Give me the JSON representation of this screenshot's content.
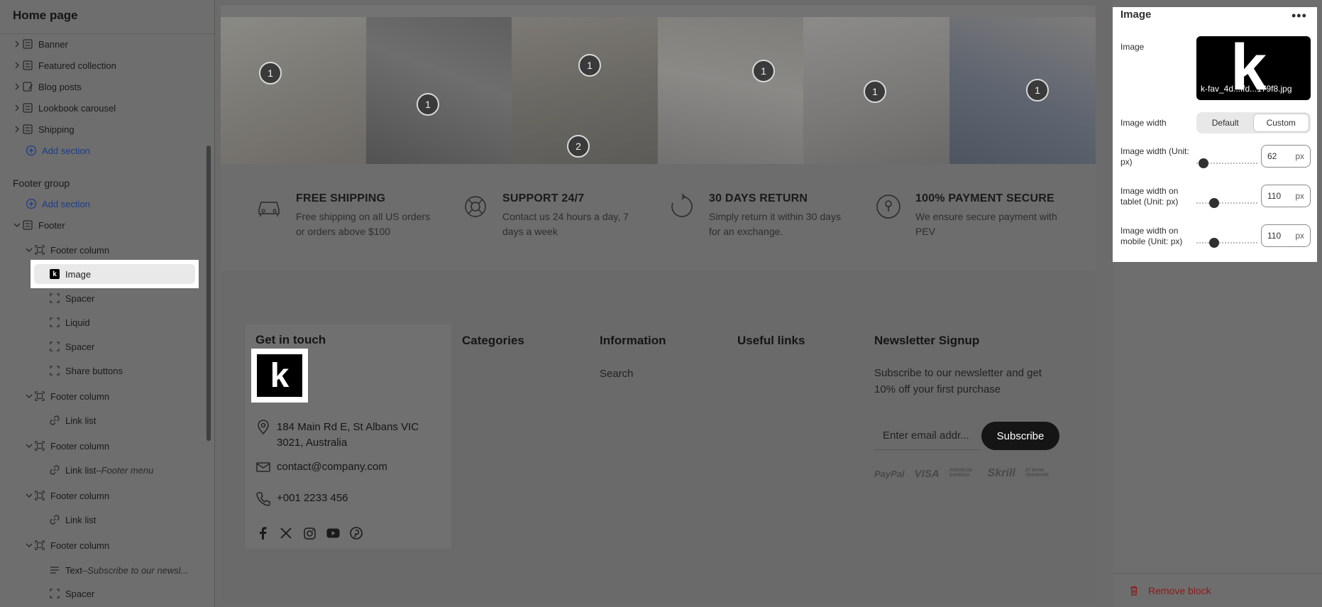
{
  "sidebar": {
    "title": "Home page",
    "sections": [
      {
        "label": "Banner",
        "icon": "section-icon"
      },
      {
        "label": "Featured collection",
        "icon": "section-icon"
      },
      {
        "label": "Blog posts",
        "icon": "blog-icon"
      },
      {
        "label": "Lookbook carousel",
        "icon": "section-icon"
      },
      {
        "label": "Shipping",
        "icon": "section-icon"
      }
    ],
    "add_section": "Add section",
    "footer_group_title": "Footer group",
    "footer_add_section": "Add section",
    "footer_label": "Footer",
    "footer_tree": [
      {
        "label": "Footer column",
        "suffix": ""
      },
      {
        "label": "Image",
        "suffix": ""
      },
      {
        "label": "Spacer",
        "suffix": ""
      },
      {
        "label": "Liquid",
        "suffix": ""
      },
      {
        "label": "Spacer",
        "suffix": ""
      },
      {
        "label": "Share buttons",
        "suffix": ""
      },
      {
        "label": "Footer column",
        "suffix": ""
      },
      {
        "label": "Link list",
        "suffix": ""
      },
      {
        "label": "Footer column",
        "suffix": ""
      },
      {
        "label": "Link list",
        "suffix": "Footer menu"
      },
      {
        "label": "Footer column",
        "suffix": ""
      },
      {
        "label": "Link list",
        "suffix": ""
      },
      {
        "label": "Footer column",
        "suffix": ""
      },
      {
        "label": "Text",
        "suffix": "Subscribe to our newsl..."
      },
      {
        "label": "Spacer",
        "suffix": ""
      }
    ],
    "dash": " – "
  },
  "preview": {
    "hotspots": [
      "1",
      "1",
      "1",
      "2",
      "1",
      "1",
      "1"
    ],
    "features": [
      {
        "title": "FREE SHIPPING",
        "text": "Free shipping on all US orders or orders above $100",
        "icon": "car-icon"
      },
      {
        "title": "SUPPORT 24/7",
        "text": "Contact us 24 hours a day, 7 days a week",
        "icon": "lifebuoy-icon"
      },
      {
        "title": "30 DAYS RETURN",
        "text": "Simply return it within 30 days for an exchange.",
        "icon": "return-icon"
      },
      {
        "title": "100% PAYMENT SECURE",
        "text": "We ensure secure payment with PEV",
        "icon": "lock-icon"
      }
    ],
    "footer": {
      "get_in_touch": "Get in touch",
      "logo_letter": "k",
      "address": "184 Main Rd E, St Albans VIC 3021, Australia",
      "email": "contact@company.com",
      "phone": "+001 2233 456",
      "categories_title": "Categories",
      "information_title": "Information",
      "information_links": [
        "Search"
      ],
      "useful_links_title": "Useful links",
      "newsletter_title": "Newsletter Signup",
      "newsletter_text": "Subscribe to our newsletter and get 10% off your first purchase",
      "email_placeholder": "Enter email addr...",
      "subscribe_label": "Subscribe",
      "payments": [
        "PayPal",
        "VISA",
        "AMERICAN EXPRESS",
        "Skrill",
        "ST BANK TRANSFER"
      ]
    }
  },
  "settings": {
    "title": "Image",
    "image_label": "Image",
    "image_letter": "k",
    "image_filename": "k-fav_4d...ffd...179f8.jpg",
    "image_width_label": "Image width",
    "image_width_options": [
      "Default",
      "Custom"
    ],
    "image_width_selected": "Custom",
    "width_px_label": "Image width (Unit: px)",
    "width_px_value": "62",
    "tablet_label": "Image width on tablet (Unit: px)",
    "tablet_value": "110",
    "mobile_label": "Image width on mobile (Unit: px)",
    "mobile_value": "110",
    "unit": "px",
    "remove_label": "Remove block"
  }
}
